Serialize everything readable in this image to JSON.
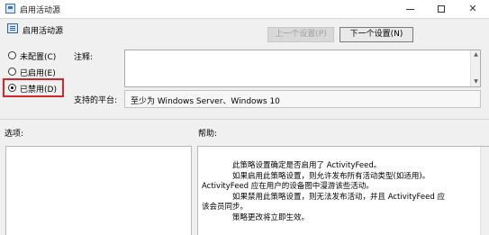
{
  "window": {
    "title": "启用活动源"
  },
  "header": {
    "title": "启用活动源",
    "prev_label": "上一个设置(P)",
    "next_label": "下一个设置(N)"
  },
  "options": [
    {
      "label": "未配置(C)",
      "checked": false
    },
    {
      "label": "已启用(E)",
      "checked": false
    },
    {
      "label": "已禁用(D)",
      "checked": true
    }
  ],
  "comment": {
    "label": "注释:",
    "value": ""
  },
  "platform": {
    "label": "支持的平台:",
    "value": "至少为 Windows Server、Windows 10"
  },
  "sections": {
    "options_label": "选项:",
    "help_label": "帮助:"
  },
  "help": {
    "lines": [
      "此策略设置确定是否启用了 ActivityFeed。",
      "如果启用此策略设置，则允许发布所有活动类型(如适用)。",
      "ActivityFeed 应在用户的设备图中漫游该些活动。",
      "如果禁用此策略设置，则无法发布活动，并且 ActivityFeed 应",
      "该会员同步。",
      "策略更改将立即生效。"
    ]
  },
  "colors": {
    "highlight_border": "#d6262d"
  }
}
